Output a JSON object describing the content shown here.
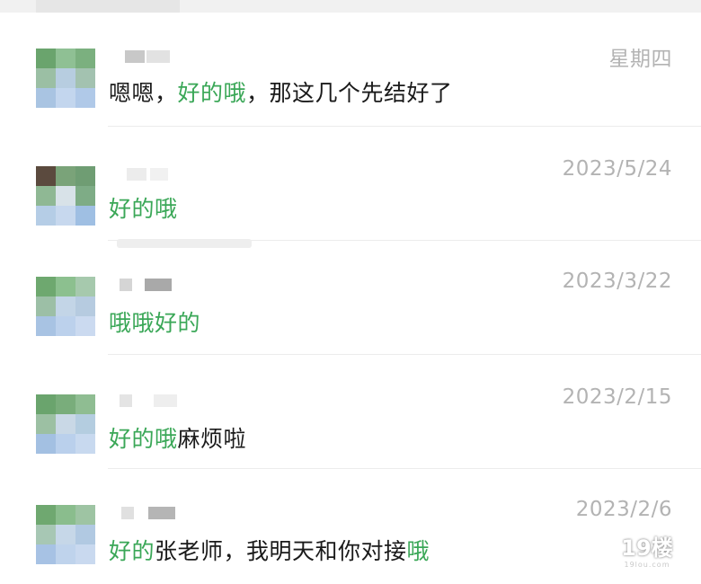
{
  "conversations": [
    {
      "date": "星期四",
      "message_parts": [
        {
          "text": "嗯嗯，",
          "highlight": false
        },
        {
          "text": "好的哦",
          "highlight": true
        },
        {
          "text": "，那这几个先结好了",
          "highlight": false
        }
      ]
    },
    {
      "date": "2023/5/24",
      "message_parts": [
        {
          "text": "好的哦",
          "highlight": true
        }
      ]
    },
    {
      "date": "2023/3/22",
      "message_parts": [
        {
          "text": "哦哦好的",
          "highlight": true
        }
      ]
    },
    {
      "date": "2023/2/15",
      "message_parts": [
        {
          "text": "好的哦",
          "highlight": true
        },
        {
          "text": "麻烦啦",
          "highlight": false
        }
      ]
    },
    {
      "date": "2023/2/6",
      "message_parts": [
        {
          "text": "好的",
          "highlight": true
        },
        {
          "text": "张老师，我明天和你对接",
          "highlight": false
        },
        {
          "text": "哦",
          "highlight": true
        }
      ]
    }
  ],
  "watermark": {
    "logo_text": "19楼",
    "sub_text": "19lou.com"
  },
  "colors": {
    "highlight": "#3aa757",
    "text": "#1a1a1a",
    "date": "#b3b3b3",
    "divider": "#ececec"
  },
  "icons": {
    "avatar": "pixelated-avatar",
    "name": "blurred-contact-name"
  }
}
